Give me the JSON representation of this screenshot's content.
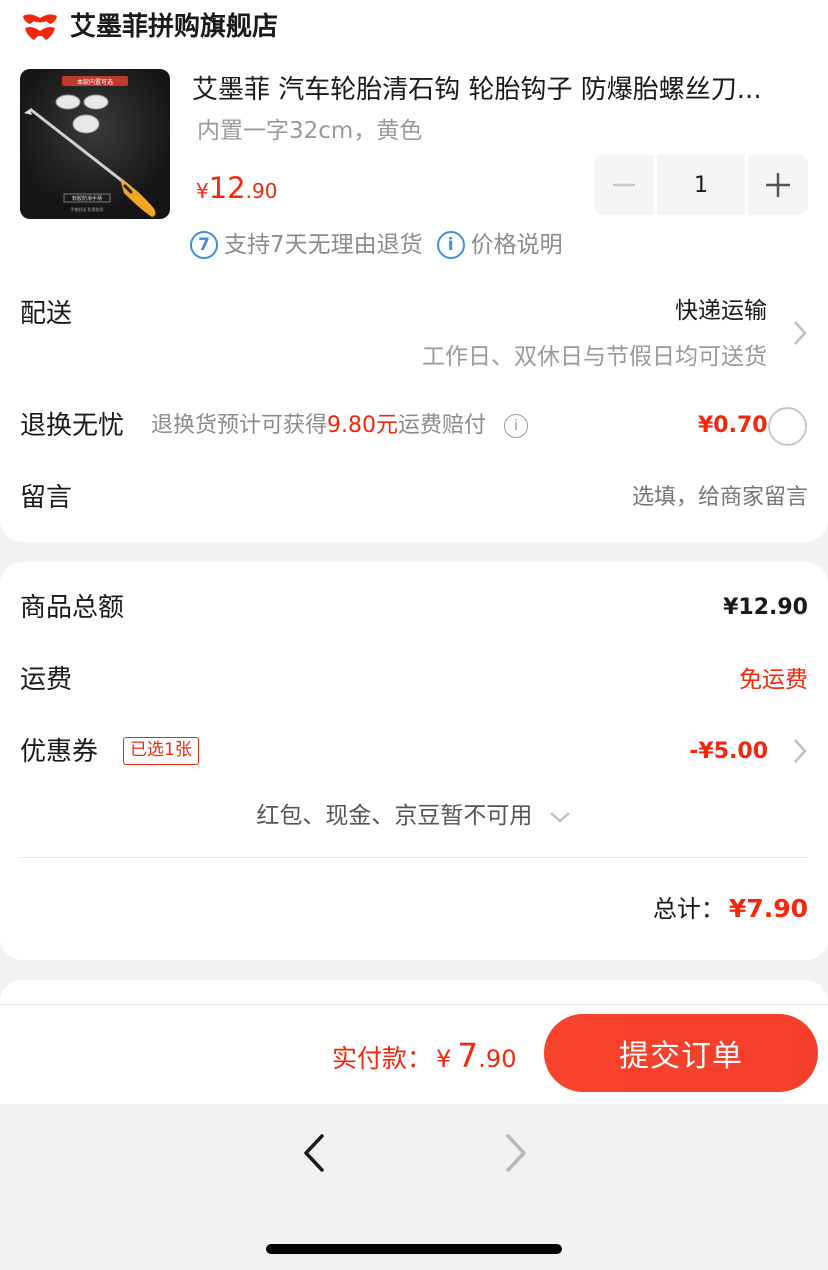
{
  "shop": {
    "name": "艾墨菲拼购旗舰店",
    "logo_icon": "jd-store-logo-icon",
    "brand_color": "#f2270c"
  },
  "product": {
    "title": "艾墨菲 汽车轮胎清石钩 轮胎钩子 防爆胎螺丝刀...",
    "spec": "内置一字32cm，黄色",
    "price_symbol": "¥",
    "price_integer": "12",
    "price_decimal": ".90",
    "quantity": "1",
    "minus_icon": "minus-icon",
    "plus_icon": "plus-icon",
    "thumb_caption_top": "本款内置可选",
    "thumb_caption_bottom": "软胶防滑手柄",
    "thumb_caption_small": "手感舒适 防滑耐用"
  },
  "services": {
    "return_badge": "7",
    "return_text": "支持7天无理由退货",
    "price_info_badge": "i",
    "price_info_text": "价格说明"
  },
  "delivery": {
    "label": "配送",
    "method": "快递运输",
    "note": "工作日、双休日与节假日均可送货"
  },
  "return_insurance": {
    "label": "退换无忧",
    "desc_prefix": "退换货预计可获得",
    "desc_amount": "9.80元",
    "desc_suffix": "运费赔付",
    "info_badge": "i",
    "price": "¥0.70"
  },
  "message": {
    "label": "留言",
    "placeholder": "选填，给商家留言"
  },
  "summary": {
    "goods_label": "商品总额",
    "goods_value": "¥12.90",
    "shipping_label": "运费",
    "shipping_value": "免运费",
    "coupon_label": "优惠券",
    "coupon_badge": "已选1张",
    "coupon_value": "-¥5.00",
    "redpack_text": "红包、现金、京豆暂不可用",
    "total_label": "总计：",
    "total_value": "¥7.90"
  },
  "bottom": {
    "pay_label": "实付款：",
    "pay_symbol": "¥",
    "pay_integer": "7",
    "pay_decimal": ".90",
    "submit_label": "提交订单"
  },
  "browser": {
    "back_icon": "chevron-left-icon",
    "forward_icon": "chevron-right-icon"
  }
}
